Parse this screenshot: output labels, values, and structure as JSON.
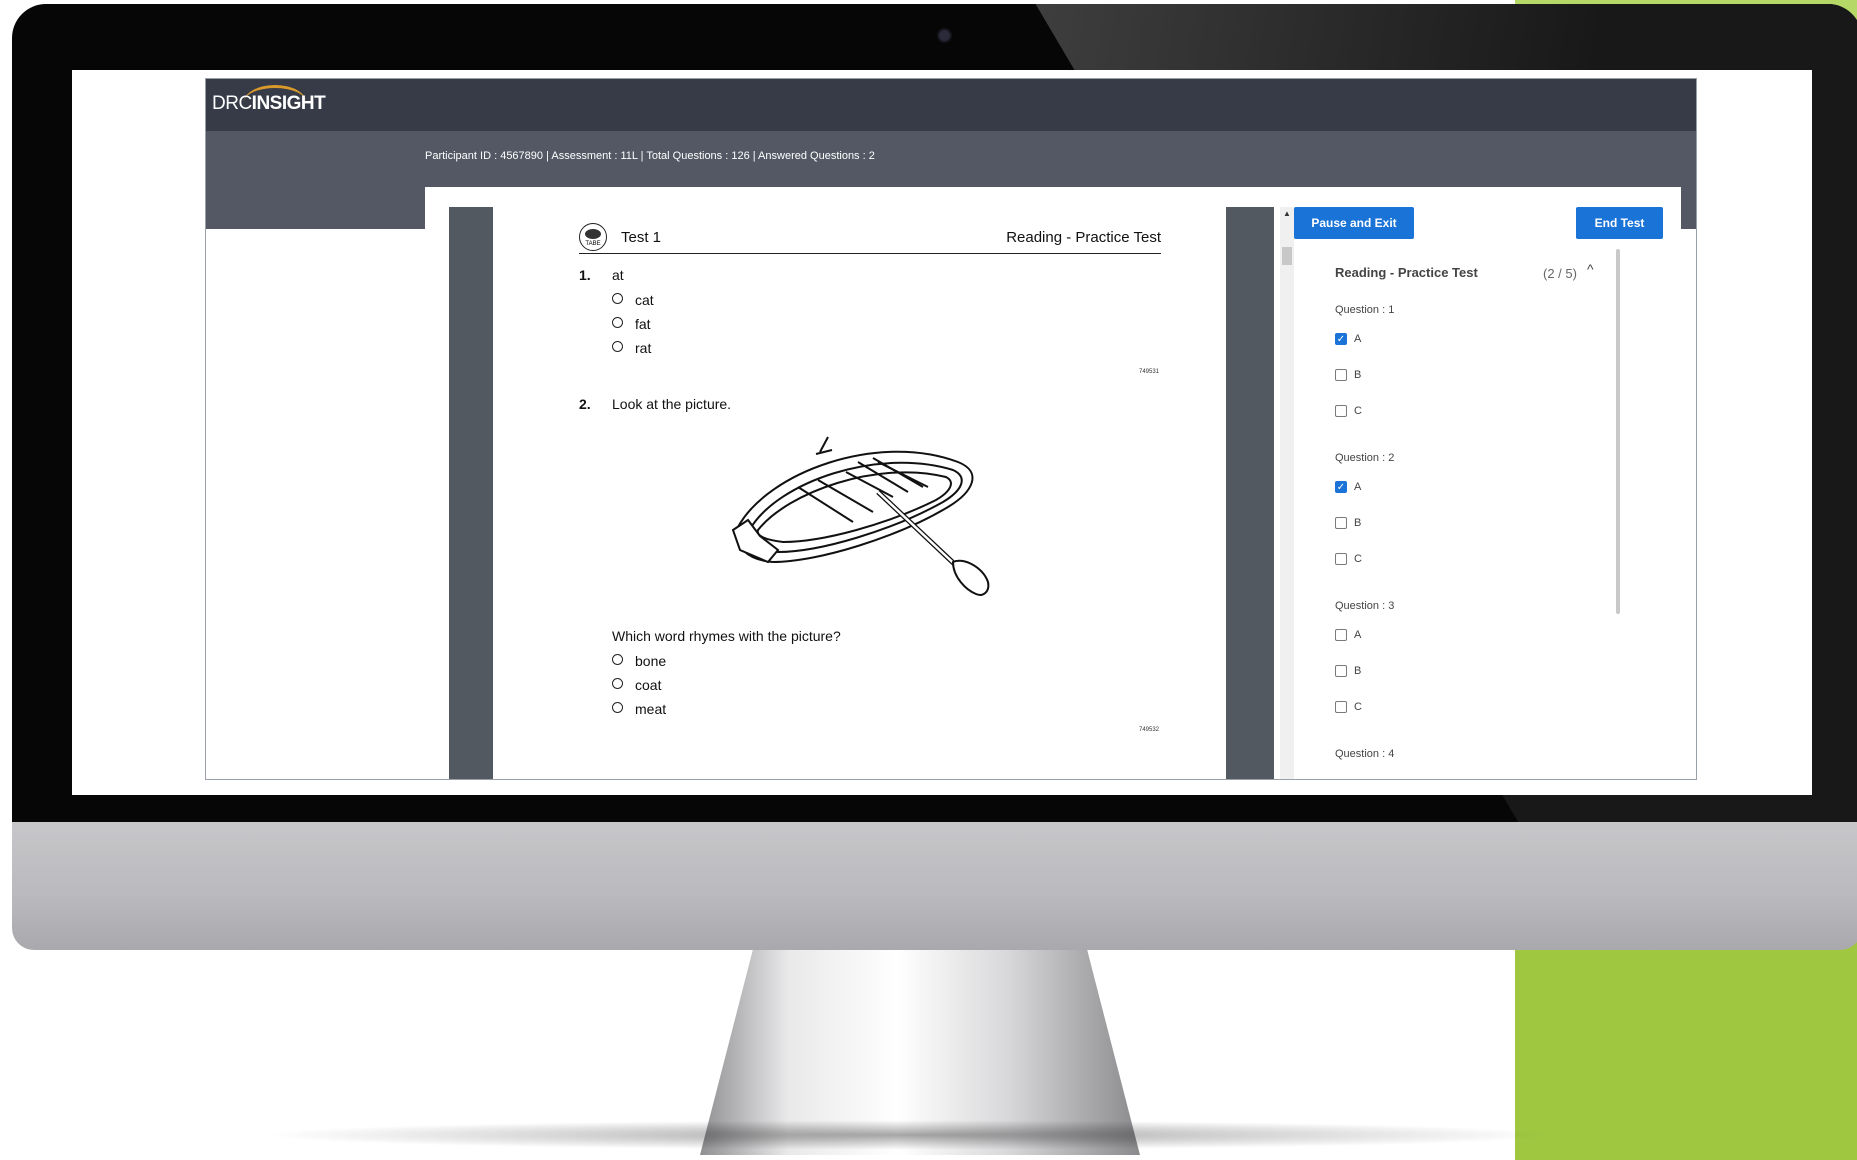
{
  "brand": {
    "drc": "DRC",
    "insight": "INSIGHT"
  },
  "info_bar": "Participant ID : 4567890 | Assessment : 11L | Total Questions : 126 | Answered Questions : 2",
  "page": {
    "header_left": "Test 1",
    "header_right": "Reading - Practice Test",
    "logo_text": "TABE",
    "questions": [
      {
        "number": "1.",
        "prompt": "at",
        "options": [
          "cat",
          "fat",
          "rat"
        ],
        "code": "749531"
      },
      {
        "number": "2.",
        "prompt": "Look at the picture.",
        "question": "Which word rhymes with the picture?",
        "options": [
          "bone",
          "coat",
          "meat"
        ],
        "code": "749532"
      }
    ]
  },
  "buttons": {
    "pause": "Pause and Exit",
    "end": "End Test"
  },
  "nav": {
    "title": "Reading - Practice Test",
    "count": "(2 / 5)",
    "caret": "^",
    "questions": [
      {
        "label": "Question : 1",
        "options": [
          {
            "label": "A",
            "checked": true
          },
          {
            "label": "B",
            "checked": false
          },
          {
            "label": "C",
            "checked": false
          }
        ]
      },
      {
        "label": "Question : 2",
        "options": [
          {
            "label": "A",
            "checked": true
          },
          {
            "label": "B",
            "checked": false
          },
          {
            "label": "C",
            "checked": false
          }
        ]
      },
      {
        "label": "Question : 3",
        "options": [
          {
            "label": "A",
            "checked": false
          },
          {
            "label": "B",
            "checked": false
          },
          {
            "label": "C",
            "checked": false
          }
        ]
      },
      {
        "label": "Question : 4"
      }
    ]
  },
  "colors": {
    "accent": "#1a73d6",
    "header": "#363b47",
    "infobar": "#535864",
    "brand_arc": "#d99a2b",
    "green": "#9fc740"
  }
}
